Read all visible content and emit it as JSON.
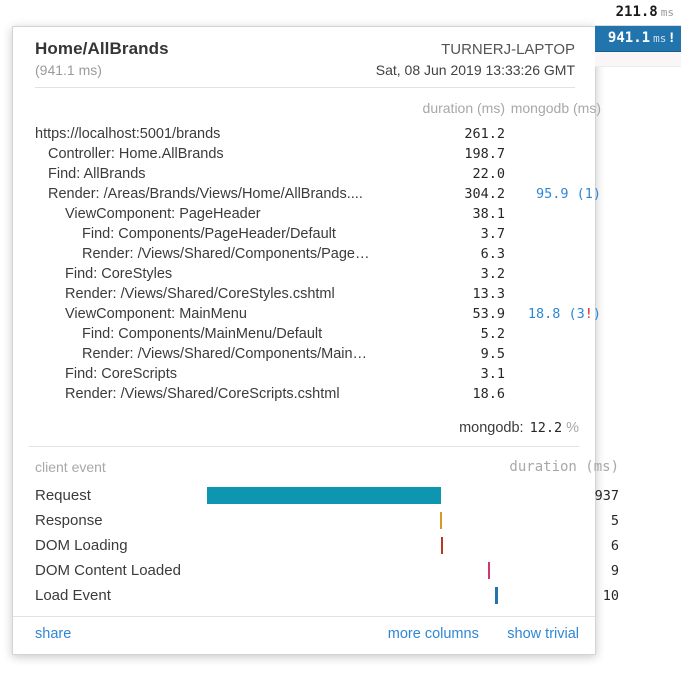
{
  "results_index": {
    "items": [
      {
        "duration": "211.8",
        "unit": "ms",
        "bang": "",
        "active": false
      },
      {
        "duration": "941.1",
        "unit": "ms",
        "bang": "!",
        "active": true
      }
    ]
  },
  "panel": {
    "header": {
      "name": "Home/AllBrands",
      "machine": "TURNERJ-LAPTOP",
      "duration": "(941.1 ms)",
      "timestamp": "Sat, 08 Jun 2019 13:33:26 GMT"
    },
    "timings": {
      "columns": {
        "label": "",
        "duration": "duration (ms)",
        "custom": "mongodb (ms)"
      },
      "rows": [
        {
          "label": "https://localhost:5001/brands",
          "depth": 0,
          "duration": "261.2",
          "mongo": "",
          "mongo_warn": ""
        },
        {
          "label": "Controller: Home.AllBrands",
          "depth": 1,
          "duration": "198.7",
          "mongo": "",
          "mongo_warn": ""
        },
        {
          "label": "Find: AllBrands",
          "depth": 1,
          "duration": "22.0",
          "mongo": "",
          "mongo_warn": ""
        },
        {
          "label": "Render: /Areas/Brands/Views/Home/AllBrands....",
          "depth": 1,
          "duration": "304.2",
          "mongo": "95.9 (1)",
          "mongo_warn": ""
        },
        {
          "label": "ViewComponent: PageHeader",
          "depth": 2,
          "duration": "38.1",
          "mongo": "",
          "mongo_warn": ""
        },
        {
          "label": "Find: Components/PageHeader/Default",
          "depth": 3,
          "duration": "3.7",
          "mongo": "",
          "mongo_warn": ""
        },
        {
          "label": "Render: /Views/Shared/Components/Page…",
          "depth": 3,
          "duration": "6.3",
          "mongo": "",
          "mongo_warn": ""
        },
        {
          "label": "Find: CoreStyles",
          "depth": 2,
          "duration": "3.2",
          "mongo": "",
          "mongo_warn": ""
        },
        {
          "label": "Render: /Views/Shared/CoreStyles.cshtml",
          "depth": 2,
          "duration": "13.3",
          "mongo": "",
          "mongo_warn": ""
        },
        {
          "label": "ViewComponent: MainMenu",
          "depth": 2,
          "duration": "53.9",
          "mongo_pre": "18.8 (3",
          "mongo_warn": "!",
          "mongo_post": ")"
        },
        {
          "label": "Find: Components/MainMenu/Default",
          "depth": 3,
          "duration": "5.2",
          "mongo": "",
          "mongo_warn": ""
        },
        {
          "label": "Render: /Views/Shared/Components/Main…",
          "depth": 3,
          "duration": "9.5",
          "mongo": "",
          "mongo_warn": ""
        },
        {
          "label": "Find: CoreScripts",
          "depth": 2,
          "duration": "3.1",
          "mongo": "",
          "mongo_warn": ""
        },
        {
          "label": "Render: /Views/Shared/CoreScripts.cshtml",
          "depth": 2,
          "duration": "18.6",
          "mongo": "",
          "mongo_warn": ""
        }
      ],
      "aggregate": {
        "label": "mongodb:",
        "value": "12.2",
        "unit": "%"
      }
    },
    "client_timings": {
      "columns": {
        "name": "client event",
        "graph": "",
        "duration": "duration (ms)"
      },
      "rows": [
        {
          "name": "Request",
          "duration": "937",
          "bar_left_pct": 0.0,
          "bar_width_pct": 79.0,
          "color": "#0e96b0"
        },
        {
          "name": "Response",
          "duration": "5",
          "bar_left_pct": 78.7,
          "bar_width_pct": 0.7,
          "color": "#d69a28"
        },
        {
          "name": "DOM Loading",
          "duration": "6",
          "bar_left_pct": 78.9,
          "bar_width_pct": 0.6,
          "color": "#b8391d"
        },
        {
          "name": "DOM Content Loaded",
          "duration": "9",
          "bar_left_pct": 95.0,
          "bar_width_pct": 0.7,
          "color": "#d1366f"
        },
        {
          "name": "Load Event",
          "duration": "10",
          "bar_left_pct": 97.3,
          "bar_width_pct": 1.0,
          "color": "#2274ad"
        }
      ]
    },
    "footer": {
      "share": "share",
      "more_columns": "more columns",
      "show_trivial": "show trivial"
    }
  },
  "colors": {
    "accent_blue": "#2274ad",
    "link_blue": "#2f87d4",
    "warn_red": "#e02020",
    "request_teal": "#0e96b0"
  }
}
